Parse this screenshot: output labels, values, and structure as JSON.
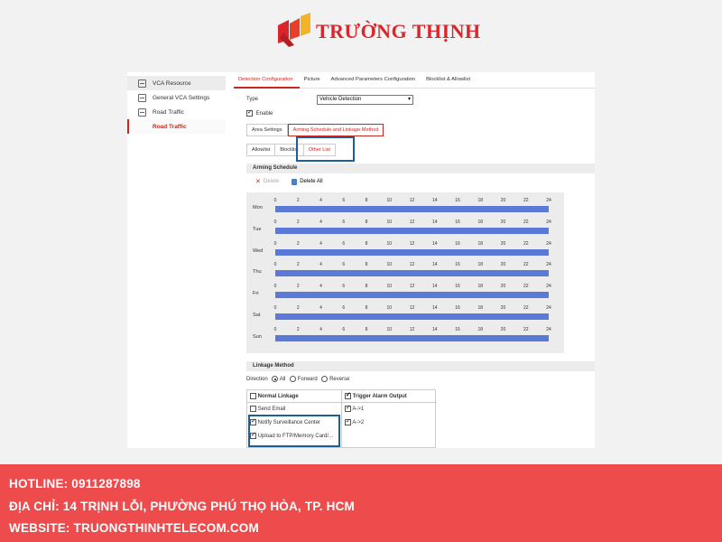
{
  "brand": {
    "name": "TRƯỜNG THỊNH",
    "colors": {
      "red": "#d8262b",
      "gold": "#f2b32a"
    }
  },
  "sidebar": {
    "items": [
      {
        "label": "VCA Resource",
        "icon": "resource-icon"
      },
      {
        "label": "General VCA Settings",
        "icon": "settings-icon"
      },
      {
        "label": "Road Traffic",
        "icon": "road-traffic-icon"
      },
      {
        "label": "Road Traffic"
      }
    ]
  },
  "tabs": [
    "Detection Configuration",
    "Picture",
    "Advanced Parameters Configuration",
    "Blocklist & Allowlist"
  ],
  "type_label": "Type",
  "type_value": "Vehicle Detection",
  "enable_label": "Enable",
  "subtabs": [
    "Area Settings",
    "Arming Schedule and Linkage Method"
  ],
  "listtabs": [
    "Allowlist",
    "Blocklist",
    "Other List"
  ],
  "arming_schedule": {
    "title": "Arming Schedule",
    "delete_label": "Delete",
    "delete_all_label": "Delete All",
    "hours": [
      "0",
      "2",
      "4",
      "6",
      "8",
      "10",
      "12",
      "14",
      "16",
      "18",
      "20",
      "22",
      "24"
    ],
    "days": [
      "Mon",
      "Tue",
      "Wed",
      "Thu",
      "Fri",
      "Sat",
      "Sun"
    ]
  },
  "linkage": {
    "title": "Linkage Method",
    "direction_label": "Direction",
    "options": [
      "All",
      "Forward",
      "Reverse"
    ],
    "normal_linkage": "Normal Linkage",
    "trigger_alarm_output": "Trigger Alarm Output",
    "send_email": "Send Email",
    "notify_center": "Notify Surveillance Center",
    "upload_ftp": "Upload to FTP/Memory Card/...",
    "a1": "A->1",
    "a2": "A->2"
  },
  "banner": {
    "hotline": "HOTLINE: 0911287898",
    "address": "ĐỊA CHỈ: 14 TRỊNH LỖI, PHƯỜNG PHÚ THỌ HÒA, TP. HCM",
    "website": "WEBSITE: TRUONGTHINHTELECOM.COM",
    "color": "#ee4b4c"
  }
}
